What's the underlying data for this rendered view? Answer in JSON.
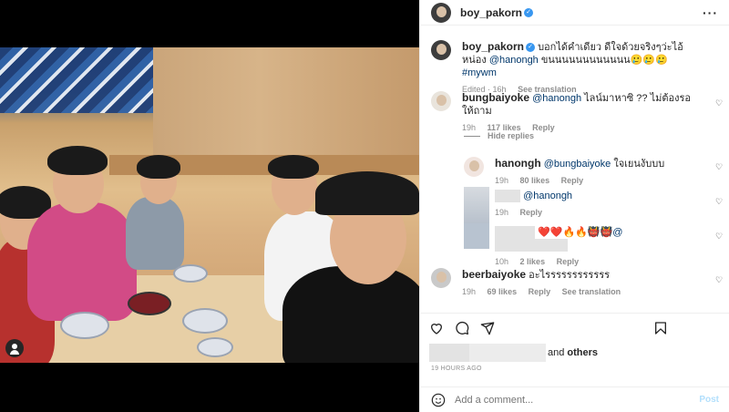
{
  "post": {
    "username": "boy_pakorn",
    "caption_text": "บอกได้คำเดียว ดีใจด้วยจริงๆว่ะไอ้หน่อง",
    "caption_mention": "@hanongh",
    "caption_suffix": "ขนนนนนนนนนนนน🥲🥲🥲",
    "caption_hashtag": "#mywm",
    "edited_label": "Edited · 16h",
    "see_translation": "See translation",
    "timestamp": "19 HOURS AGO",
    "likes_and": "and",
    "likes_others": "others"
  },
  "comments": [
    {
      "username": "bungbaiyoke",
      "mention": "@hanongh",
      "text": "ไลน์มาหาซิ ?? ไม่ต้องรอให้ถาม",
      "time": "19h",
      "likes": "117 likes",
      "reply": "Reply"
    },
    {
      "username": "hanongh",
      "mention": "@bungbaiyoke",
      "text": "ใจเยนงับบบ",
      "time": "19h",
      "likes": "80 likes",
      "reply": "Reply"
    },
    {
      "username": "",
      "mention": "@hanongh",
      "text": "",
      "time": "19h",
      "likes": "",
      "reply": "Reply"
    },
    {
      "username": "",
      "mention": "@",
      "text": "❤️❤️🔥🔥👹👹",
      "time": "10h",
      "likes": "2 likes",
      "reply": "Reply"
    },
    {
      "username": "beerbaiyoke",
      "mention": "",
      "text": "อะไรรรรรรรรรรรร",
      "time": "19h",
      "likes": "69 likes",
      "reply": "Reply",
      "see_translation": "See translation"
    }
  ],
  "hide_replies": "Hide replies",
  "add_comment": {
    "placeholder": "Add a comment...",
    "post_label": "Post"
  },
  "colors": {
    "link": "#00376b",
    "muted": "#8e8e8e",
    "verified": "#3897f0",
    "post_disabled": "#b2dffc"
  },
  "icons": [
    "verified-badge-icon",
    "more-options-icon",
    "heart-icon",
    "comment-icon",
    "share-icon",
    "save-icon",
    "emoji-icon",
    "user-tag-icon"
  ]
}
